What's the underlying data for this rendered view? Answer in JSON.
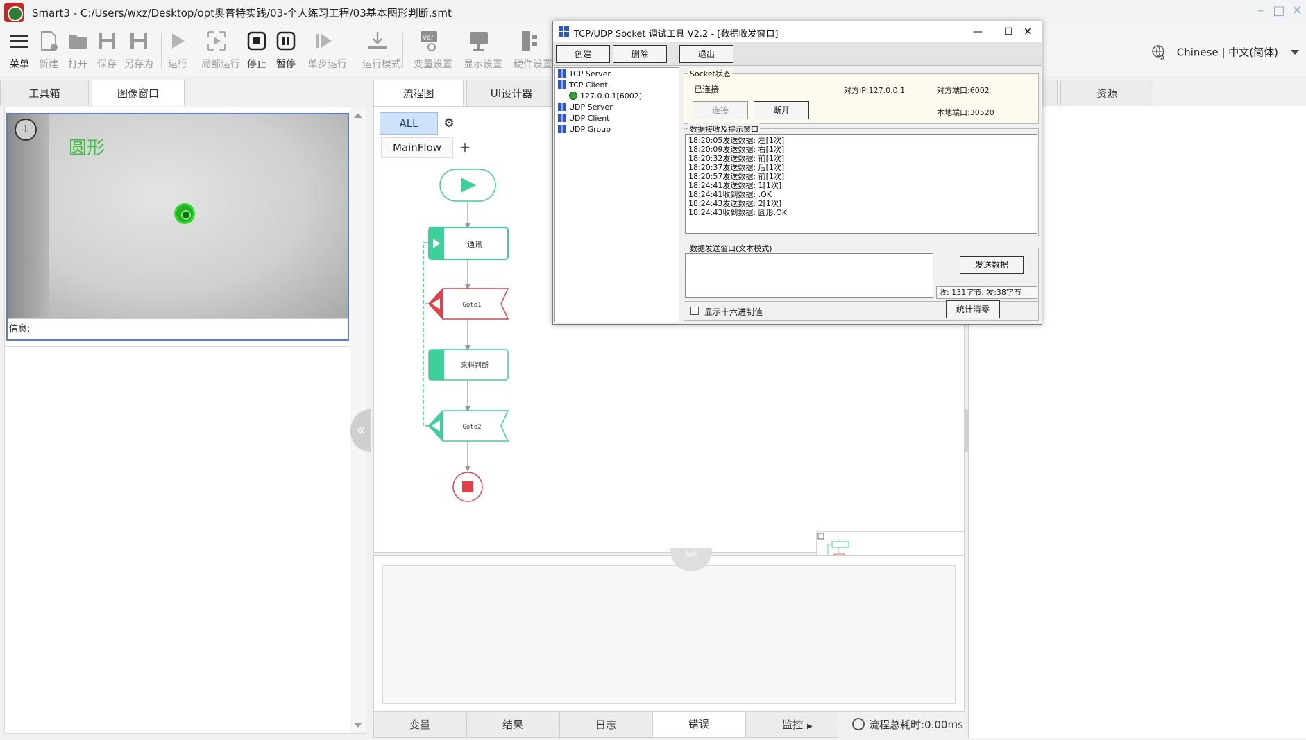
{
  "window": {
    "title": "Smart3 - C:/Users/wxz/Desktop/opt奥普特实践/03-个人练习工程/03基本图形判断.smt"
  },
  "toolbar": {
    "items": [
      {
        "label": "菜单",
        "icon": "menu-icon",
        "enabled": true
      },
      {
        "label": "新建",
        "icon": "new-file-icon",
        "enabled": false
      },
      {
        "label": "打开",
        "icon": "open-folder-icon",
        "enabled": false
      },
      {
        "label": "保存",
        "icon": "save-icon",
        "enabled": false
      },
      {
        "label": "另存为",
        "icon": "save-as-icon",
        "enabled": false
      },
      {
        "label": "运行",
        "icon": "play-icon",
        "enabled": false
      },
      {
        "label": "局部运行",
        "icon": "partial-run-icon",
        "enabled": false
      },
      {
        "label": "停止",
        "icon": "stop-icon",
        "enabled": true
      },
      {
        "label": "暂停",
        "icon": "pause-icon",
        "enabled": true
      },
      {
        "label": "单步运行",
        "icon": "step-run-icon",
        "enabled": false
      },
      {
        "label": "运行模式",
        "icon": "run-mode-icon",
        "enabled": false
      },
      {
        "label": "变量设置",
        "icon": "variable-settings-icon",
        "enabled": false
      },
      {
        "label": "显示设置",
        "icon": "display-settings-icon",
        "enabled": false
      },
      {
        "label": "硬件设置",
        "icon": "hardware-settings-icon",
        "enabled": false
      }
    ],
    "language": "Chinese | 中文(简体)"
  },
  "left_tabs": [
    "工具箱",
    "图像窗口"
  ],
  "left_active_tab": 1,
  "center_tabs": [
    "流程图",
    "UI设计器"
  ],
  "center_active_tab": 0,
  "right_tabs": [
    "资源"
  ],
  "image_window": {
    "index": "1",
    "overlay_text": "圆形",
    "info_label": "信息:"
  },
  "flow": {
    "filter": "ALL",
    "flow_tab": "MainFlow",
    "nodes": [
      {
        "type": "start",
        "label": ""
      },
      {
        "type": "task",
        "label": "通讯"
      },
      {
        "type": "goto",
        "label": "Goto1"
      },
      {
        "type": "task",
        "label": "来料判断"
      },
      {
        "type": "goto",
        "label": "Goto2"
      },
      {
        "type": "end",
        "label": ""
      }
    ]
  },
  "bottom_tabs": [
    "变量",
    "结果",
    "日志",
    "错误",
    "监控"
  ],
  "bottom_active_tab": 3,
  "flow_time": "流程总耗时:0.00ms",
  "colors": {
    "accent": "#5d7bd6",
    "flow_green": "#3ecf9a",
    "goto_red": "#e0404a",
    "result_green": "#38c038"
  },
  "socket_tool": {
    "title": "TCP/UDP Socket 调试工具 V2.2 - [数据收发窗口]",
    "buttons": {
      "create": "创建",
      "delete": "删除",
      "exit": "退出"
    },
    "tree": [
      "TCP Server",
      "TCP Client",
      "127.0.0.1[6002]",
      "UDP Server",
      "UDP Client",
      "UDP Group"
    ],
    "status_group": "Socket状态",
    "connected": "已连接",
    "peer_ip": "对方IP:127.0.0.1",
    "peer_port": "对方端口:6002",
    "local_port": "本地端口:30520",
    "connect_btn": "连接",
    "disconnect_btn": "断开",
    "recv_group": "数据接收及提示窗口",
    "log": [
      "18:20:05发送数据: 左[1次]",
      "18:20:09发送数据: 右[1次]",
      "18:20:32发送数据: 前[1次]",
      "18:20:37发送数据: 后[1次]",
      "18:20:57发送数据: 前[1次]",
      "18:24:41发送数据: 1[1次]",
      "18:24:41收到数据: .OK",
      "18:24:43发送数据: 2[1次]",
      "18:24:43收到数据: 圆形.OK"
    ],
    "send_group": "数据发送窗口(文本模式)",
    "send_btn": "发送数据",
    "stats": "收: 131字节, 发:38字节",
    "hex_checkbox": "显示十六进制值",
    "clear_btn": "统计清零"
  }
}
